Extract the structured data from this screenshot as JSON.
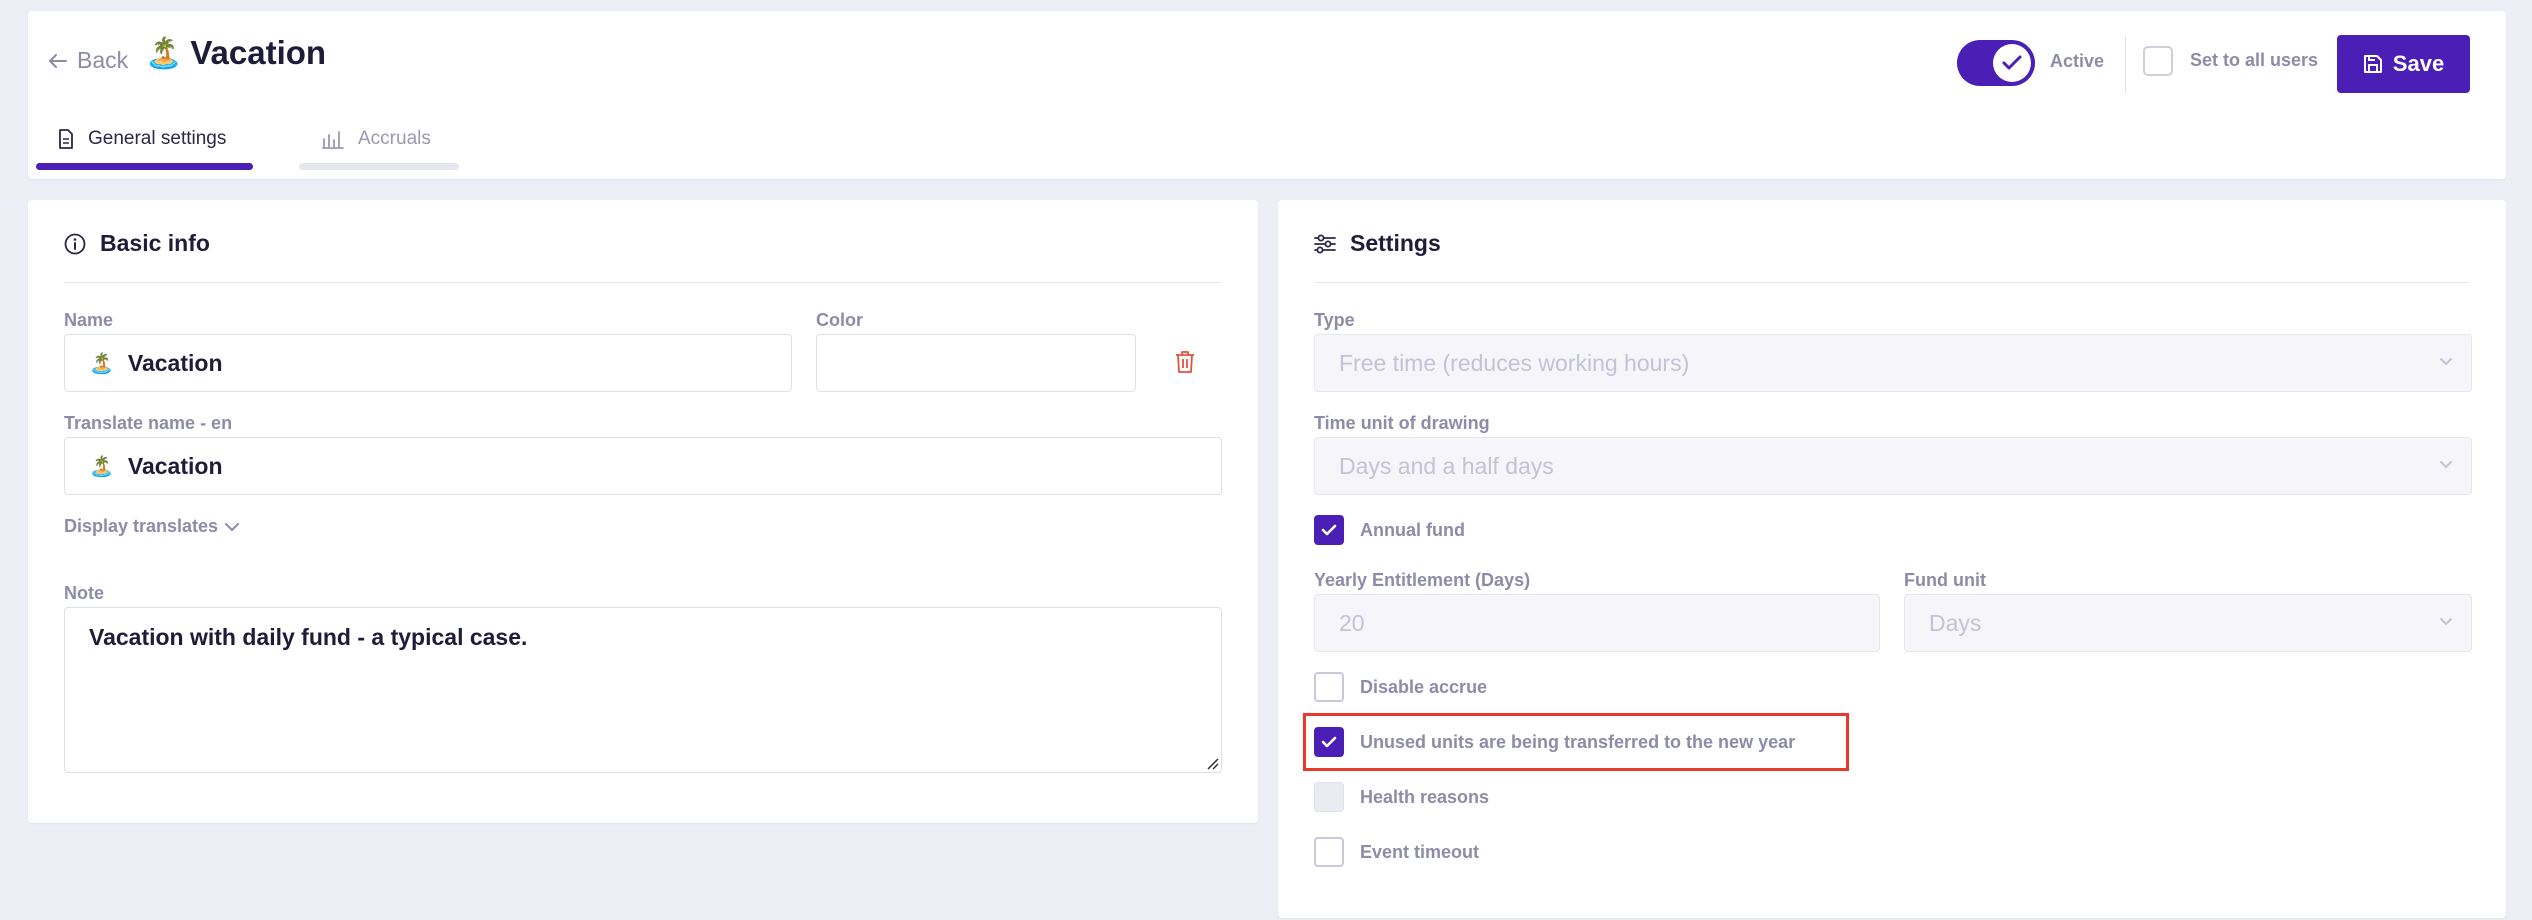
{
  "header": {
    "back_label": "Back",
    "title_emoji": "🏝️",
    "title": "Vacation",
    "tabs": [
      {
        "label": "General settings",
        "icon": "document-icon",
        "active": true
      },
      {
        "label": "Accruals",
        "icon": "bar-chart-icon",
        "active": false
      }
    ],
    "active_toggle_label": "Active",
    "active_toggle_on": true,
    "set_all_users_label": "Set to all users",
    "set_all_users_checked": false,
    "save_label": "Save"
  },
  "basic_info": {
    "title": "Basic info",
    "name_label": "Name",
    "name_emoji": "🏝️",
    "name_value": "Vacation",
    "color_label": "Color",
    "color_value": "",
    "translate_label": "Translate name - en",
    "translate_emoji": "🏝️",
    "translate_value": "Vacation",
    "display_translates_label": "Display translates",
    "note_label": "Note",
    "note_value": "Vacation with daily fund - a typical case."
  },
  "settings": {
    "title": "Settings",
    "type_label": "Type",
    "type_value": "Free time (reduces working hours)",
    "time_unit_label": "Time unit of drawing",
    "time_unit_value": "Days and a half days",
    "annual_fund_label": "Annual fund",
    "annual_fund_checked": true,
    "yearly_entitlement_label": "Yearly Entitlement (Days)",
    "yearly_entitlement_value": "20",
    "fund_unit_label": "Fund unit",
    "fund_unit_value": "Days",
    "disable_accrue_label": "Disable accrue",
    "disable_accrue_checked": false,
    "unused_units_label": "Unused units are being transferred to the new year",
    "unused_units_checked": true,
    "health_reasons_label": "Health reasons",
    "health_reasons_disabled": true,
    "event_timeout_label": "Event timeout",
    "event_timeout_checked": false
  },
  "colors": {
    "primary": "#4b1fb5",
    "background": "#eeeef6",
    "highlight_border": "#e8392a",
    "delete_red": "#e0533f"
  }
}
